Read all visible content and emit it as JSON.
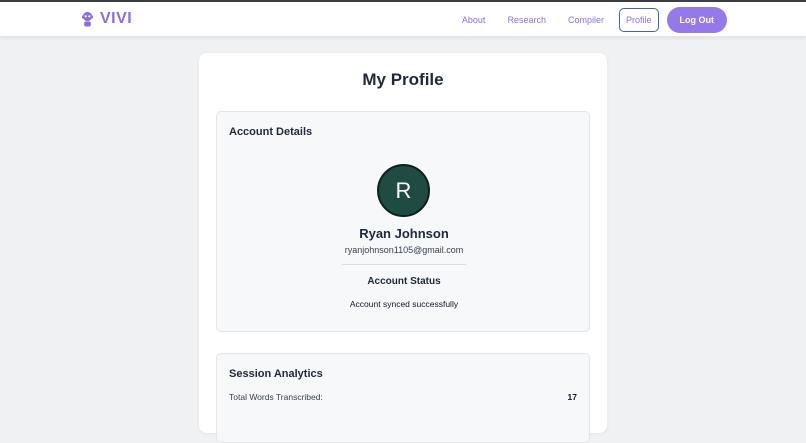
{
  "header": {
    "brand": "VIVI",
    "nav": {
      "about": "About",
      "research": "Research",
      "compiler": "Compiler",
      "profile": "Profile"
    },
    "logout_label": "Log Out"
  },
  "main": {
    "title": "My Profile",
    "account": {
      "heading": "Account Details",
      "avatar_initial": "R",
      "name": "Ryan Johnson",
      "email": "ryanjohnson1105@gmail.com",
      "status_heading": "Account Status",
      "status_text": "Account synced successfully"
    },
    "analytics": {
      "heading": "Session Analytics",
      "stats": [
        {
          "label": "Total Words Transcribed:",
          "value": "17"
        }
      ]
    }
  },
  "colors": {
    "accent": "#8b6fe0",
    "button": "#9579ea",
    "avatar": "#1f4b43"
  }
}
